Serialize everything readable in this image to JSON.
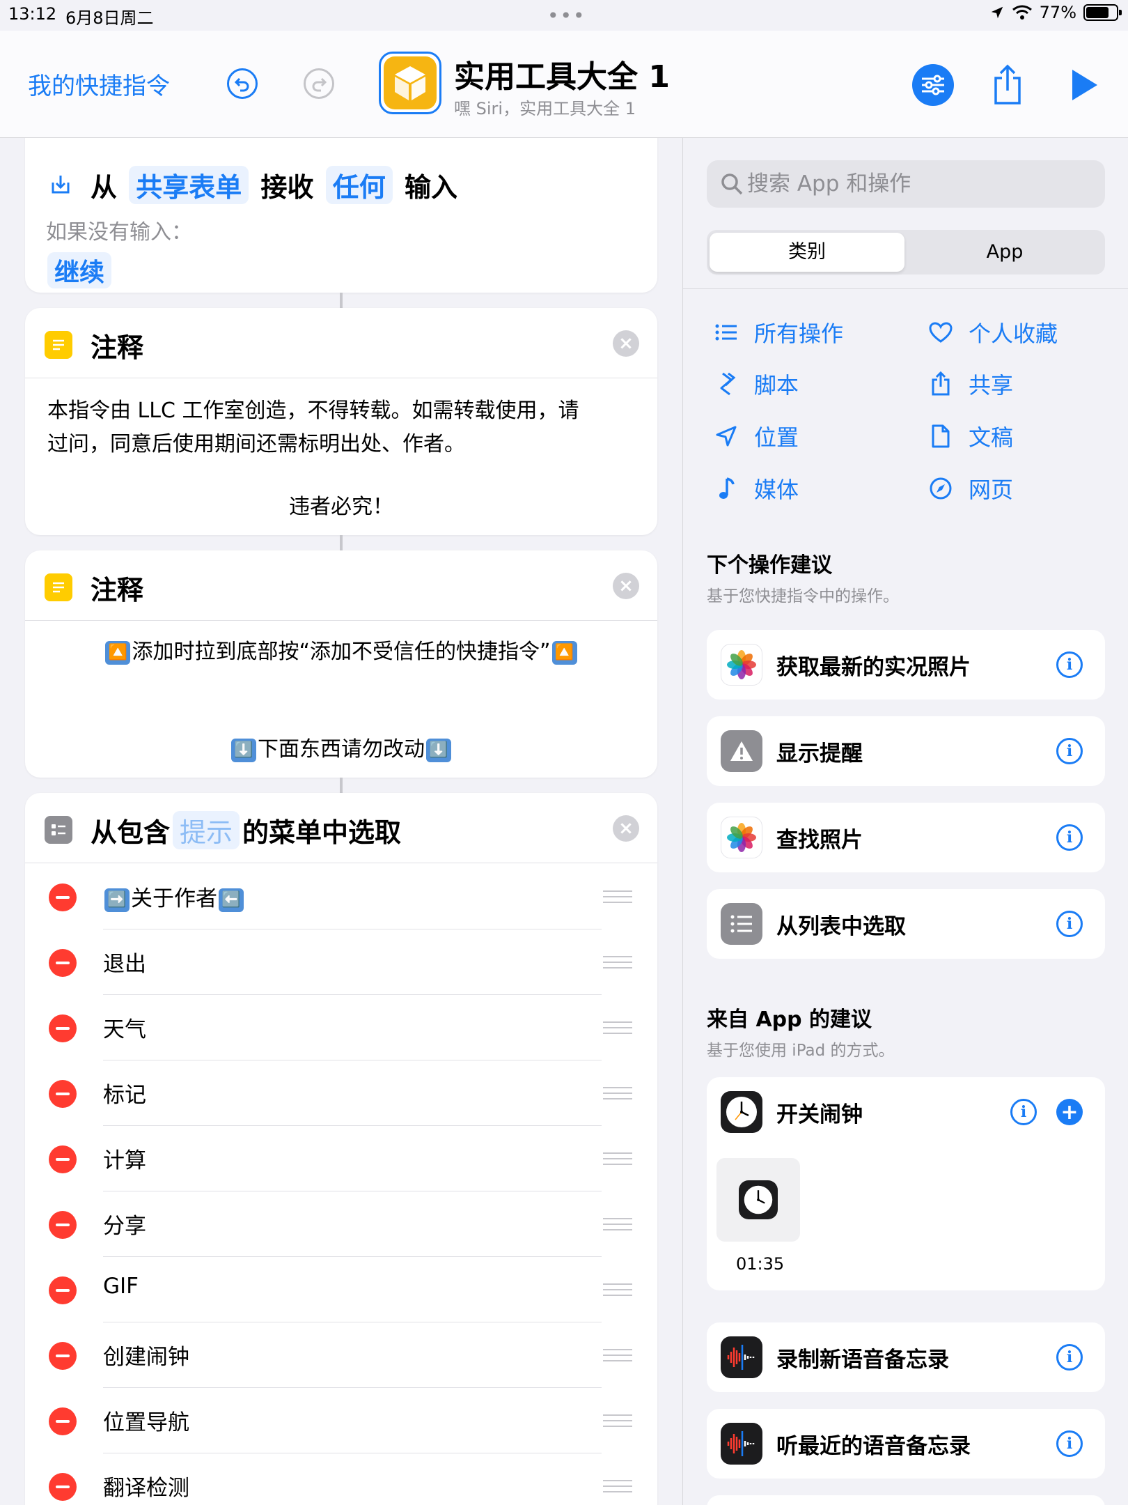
{
  "status": {
    "time": "13:12",
    "date": "6月8日周二",
    "battery_text": "77%",
    "battery_level": 0.77
  },
  "header": {
    "back_label": "我的快捷指令",
    "title": "实用工具大全 1",
    "subtitle": "嘿 Siri，实用工具大全 1"
  },
  "editor": {
    "receive_card": {
      "word_from": "从",
      "source": "共享表单",
      "word_receive": "接收",
      "type": "任何",
      "word_input": "输入",
      "if_no_input": "如果没有输入：",
      "fallback": "继续"
    },
    "note1": {
      "title": "注释",
      "line1": "本指令由 LLC 工作室创造，不得转载。如需转载使用，请",
      "line2": "过问，同意后使用期间还需标明出处、作者。",
      "line3": "违者必究！"
    },
    "note2": {
      "title": "注释",
      "line1_emoji_start": "🔼",
      "line1": "添加时拉到底部按“添加不受信任的快捷指令”",
      "line1_emoji_end": "🔼",
      "line2_emoji_start": "⬇️",
      "line2": "下面东西请勿改动",
      "line2_emoji_end": "⬇️"
    },
    "menu_card": {
      "title_prefix": "从包含",
      "prompt_placeholder": "提示",
      "title_suffix": "的菜单中选取",
      "first_item_emoji_start": "➡️",
      "first_item_text": "关于作者",
      "first_item_emoji_end": "⬅️",
      "items": [
        "退出",
        "天气",
        "标记",
        "计算",
        "分享",
        "GIF",
        "创建闹钟",
        "位置导航",
        "翻译检测"
      ]
    }
  },
  "panel": {
    "search_placeholder": "搜索 App 和操作",
    "segments": [
      "类别",
      "App"
    ],
    "categories": [
      {
        "label": "所有操作",
        "icon": "list-icon"
      },
      {
        "label": "个人收藏",
        "icon": "heart-icon"
      },
      {
        "label": "脚本",
        "icon": "script-icon"
      },
      {
        "label": "共享",
        "icon": "share-icon"
      },
      {
        "label": "位置",
        "icon": "location-arrow-icon"
      },
      {
        "label": "文稿",
        "icon": "document-icon"
      },
      {
        "label": "媒体",
        "icon": "music-note-icon"
      },
      {
        "label": "网页",
        "icon": "compass-icon"
      }
    ],
    "next_title": "下个操作建议",
    "next_sub": "基于您快捷指令中的操作。",
    "next_items": [
      {
        "name": "获取最新的实况照片",
        "icon": "photos-icon"
      },
      {
        "name": "显示提醒",
        "icon": "alert-icon"
      },
      {
        "name": "查找照片",
        "icon": "photos-icon"
      },
      {
        "name": "从列表中选取",
        "icon": "list-icon"
      }
    ],
    "app_title": "来自 App 的建议",
    "app_sub": "基于您使用 iPad 的方式。",
    "alarm": {
      "name": "开关闹钟",
      "time": "01:35"
    },
    "voice_items": [
      {
        "name": "录制新语音备忘录",
        "icon": "voice-memo-icon"
      },
      {
        "name": "听最近的语音备忘录",
        "icon": "voice-memo-icon"
      }
    ]
  },
  "colors": {
    "accent": "#1a7cf5",
    "destructive": "#ff3b30",
    "note_yellow": "#ffcc00",
    "shortcut_icon": "#f6b512"
  }
}
